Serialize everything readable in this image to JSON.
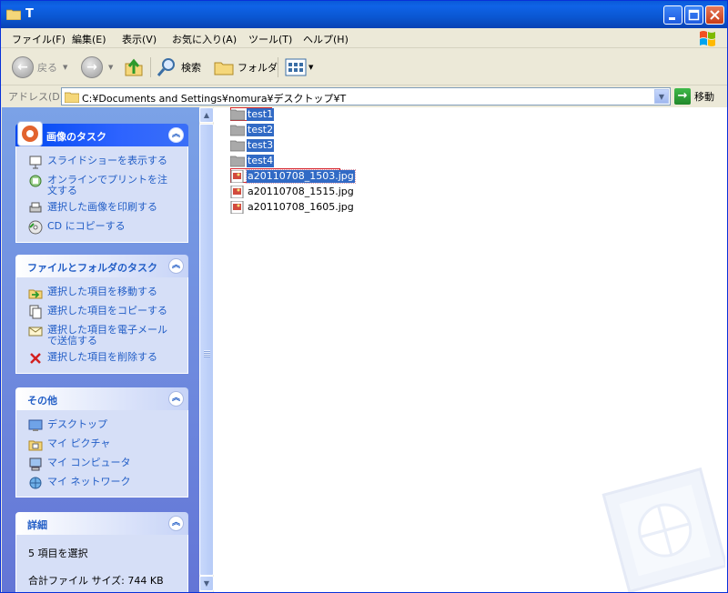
{
  "window": {
    "title": "T"
  },
  "menu": [
    "ファイル(F)",
    "編集(E)",
    "表示(V)",
    "お気に入り(A)",
    "ツール(T)",
    "ヘルプ(H)"
  ],
  "toolbar": {
    "back": "戻る",
    "search": "検索",
    "folders": "フォルダ"
  },
  "address": {
    "label": "アドレス(D)",
    "path": "C:¥Documents and Settings¥nomura¥デスクトップ¥T",
    "go": "移動"
  },
  "left_pane": {
    "image_tasks": {
      "title": "画像のタスク",
      "items": [
        "スライドショーを表示する",
        "オンラインでプリントを注文する",
        "選択した画像を印刷する",
        "CD にコピーする"
      ]
    },
    "file_tasks": {
      "title": "ファイルとフォルダのタスク",
      "items": [
        "選択した項目を移動する",
        "選択した項目をコピーする",
        "選択した項目を電子メールで送信する",
        "選択した項目を削除する"
      ]
    },
    "other_places": {
      "title": "その他",
      "items": [
        "デスクトップ",
        "マイ ピクチャ",
        "マイ コンピュータ",
        "マイ ネットワーク"
      ]
    },
    "details": {
      "title": "詳細",
      "selection": "5 項目を選択",
      "total_size": "合計ファイル サイズ: 744 KB"
    }
  },
  "files": [
    {
      "name": "test1",
      "type": "folder",
      "selected": true
    },
    {
      "name": "test2",
      "type": "folder",
      "selected": true
    },
    {
      "name": "test3",
      "type": "folder",
      "selected": true
    },
    {
      "name": "test4",
      "type": "folder",
      "selected": true
    },
    {
      "name": "a20110708_1503.jpg",
      "type": "jpg",
      "selected": true
    },
    {
      "name": "a20110708_1515.jpg",
      "type": "jpg",
      "selected": false
    },
    {
      "name": "a20110708_1605.jpg",
      "type": "jpg",
      "selected": false
    }
  ],
  "colors": {
    "title_bar": "#0a5ad8",
    "selection": "#316ac5",
    "task_link": "#215dc6",
    "left_pane": "#7ba2e7"
  }
}
